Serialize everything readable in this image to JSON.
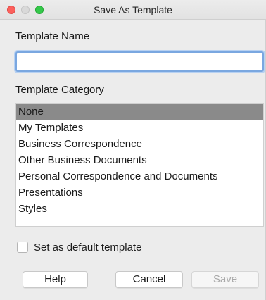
{
  "window": {
    "title": "Save As Template"
  },
  "form": {
    "name_label": "Template Name",
    "name_value": "",
    "category_label": "Template Category",
    "categories": [
      "None",
      "My Templates",
      "Business Correspondence",
      "Other Business Documents",
      "Personal Correspondence and Documents",
      "Presentations",
      "Styles"
    ],
    "selected_category": "None",
    "default_checkbox_label": "Set as default template",
    "default_checked": false
  },
  "buttons": {
    "help": "Help",
    "cancel": "Cancel",
    "save": "Save"
  },
  "colors": {
    "selection": "#8a8a8a",
    "focus_ring": "#7aa7e0",
    "close": "#fc605c",
    "maximize": "#34c84a"
  }
}
